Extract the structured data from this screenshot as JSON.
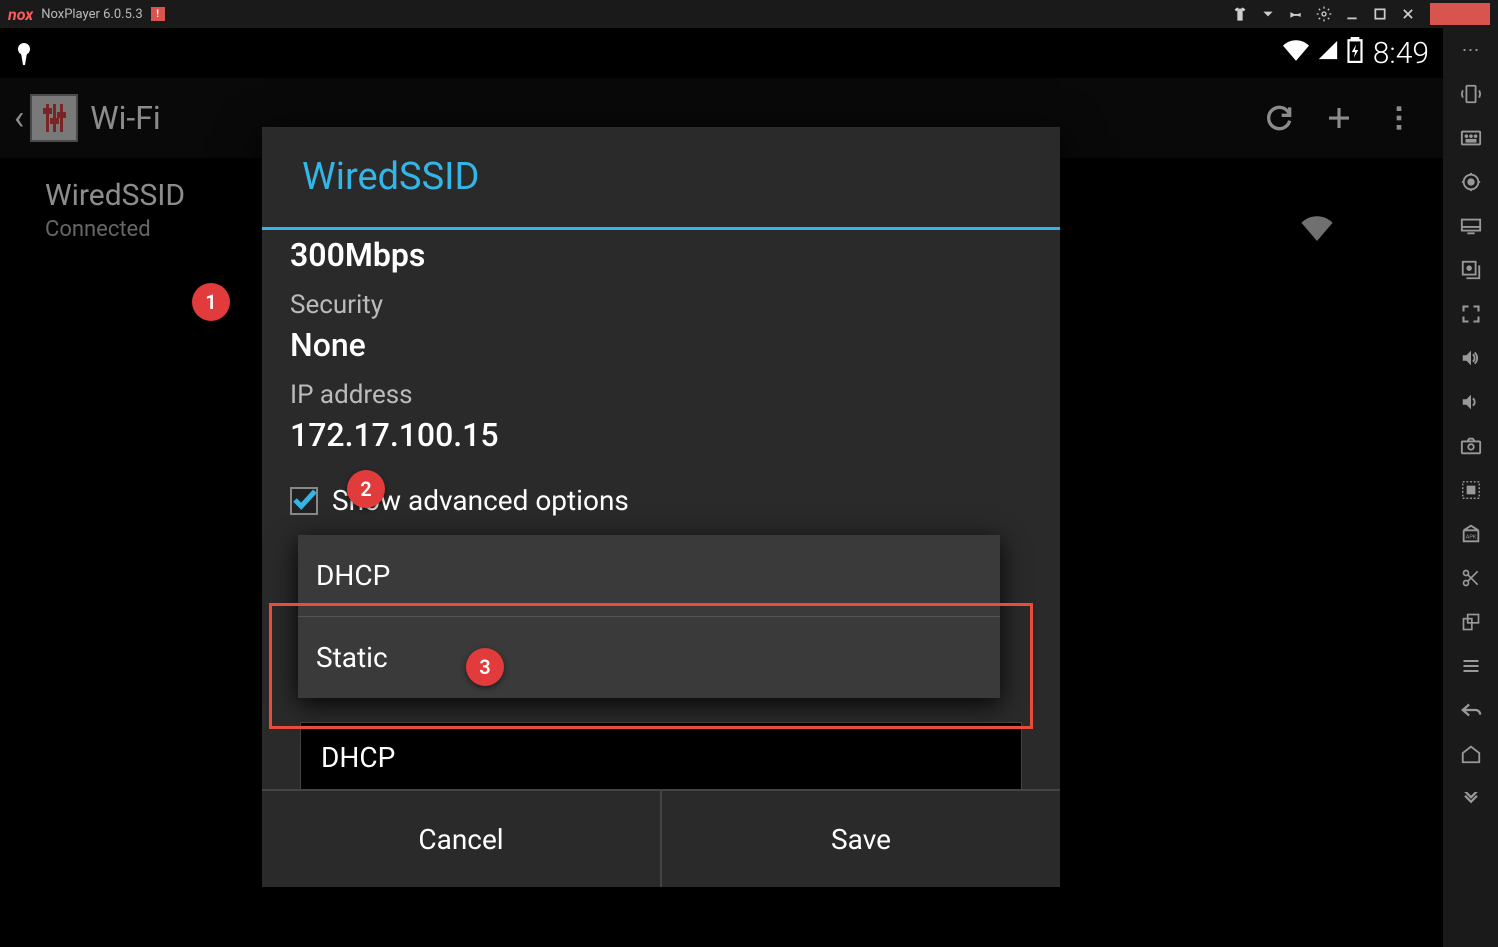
{
  "titlebar": {
    "app_name": "NoxPlayer 6.0.5.3",
    "logo": "nox"
  },
  "statusbar": {
    "time": "8:49"
  },
  "actionbar": {
    "title": "Wi-Fi"
  },
  "wifi_list": {
    "items": [
      {
        "ssid": "WiredSSID",
        "status": "Connected"
      }
    ]
  },
  "dialog": {
    "title": "WiredSSID",
    "speed": "300Mbps",
    "security_label": "Security",
    "security_value": "None",
    "ip_label": "IP address",
    "ip_value": "172.17.100.15",
    "advanced_label": "Show advanced options",
    "advanced_checked": true,
    "dhcp_current": "DHCP",
    "cancel": "Cancel",
    "save": "Save"
  },
  "dropdown": {
    "options": [
      "DHCP",
      "Static"
    ]
  },
  "annotations": {
    "b1": "1",
    "b2": "2",
    "b3": "3"
  }
}
